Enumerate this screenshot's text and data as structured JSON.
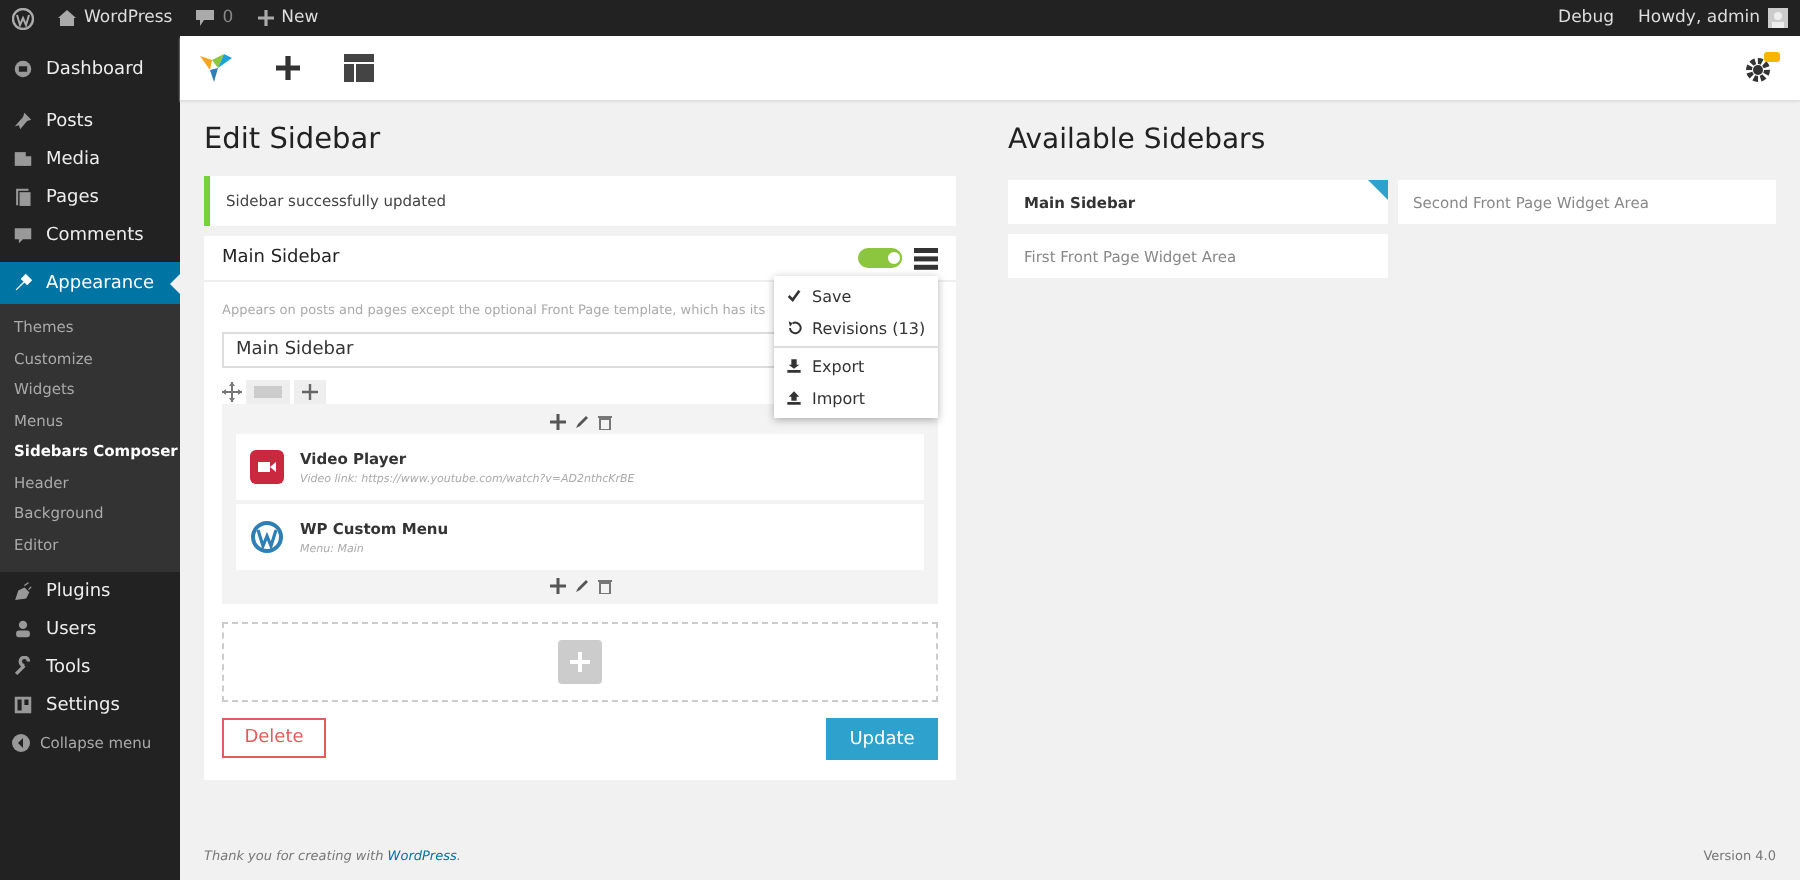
{
  "admin_bar": {
    "site": "WordPress",
    "comments": "0",
    "new": "New",
    "debug": "Debug",
    "greeting": "Howdy, admin"
  },
  "sidebar": {
    "items": [
      {
        "label": "Dashboard",
        "selected": false
      },
      {
        "label": "Posts",
        "selected": false
      },
      {
        "label": "Media",
        "selected": false
      },
      {
        "label": "Pages",
        "selected": false
      },
      {
        "label": "Comments",
        "selected": false
      },
      {
        "label": "Appearance",
        "selected": true,
        "children": [
          {
            "label": "Themes",
            "selected": false
          },
          {
            "label": "Customize",
            "selected": false
          },
          {
            "label": "Widgets",
            "selected": false
          },
          {
            "label": "Menus",
            "selected": false
          },
          {
            "label": "Sidebars Composer",
            "selected": true
          },
          {
            "label": "Header",
            "selected": false
          },
          {
            "label": "Background",
            "selected": false
          },
          {
            "label": "Editor",
            "selected": false
          }
        ]
      },
      {
        "label": "Plugins",
        "selected": false
      },
      {
        "label": "Users",
        "selected": false
      },
      {
        "label": "Tools",
        "selected": false
      },
      {
        "label": "Settings",
        "selected": false
      }
    ],
    "collapse": "Collapse menu"
  },
  "edit": {
    "title": "Edit Sidebar",
    "notice": "Sidebar successfully updated",
    "card": {
      "title": "Main Sidebar",
      "enabled": true,
      "description": "Appears on posts and pages except the optional Front Page template, which has its",
      "name_value": "Main Sidebar",
      "menu": [
        {
          "label": "Save",
          "divider_before": false
        },
        {
          "label": "Revisions (13)",
          "divider_before": false
        },
        {
          "label": "Export",
          "divider_before": true
        },
        {
          "label": "Import",
          "divider_before": false
        }
      ],
      "widgets": [
        {
          "title": "Video Player",
          "subtitle": "Video link: https://www.youtube.com/watch?v=AD2nthcKrBE",
          "kind": "video"
        },
        {
          "title": "WP Custom Menu",
          "subtitle": "Menu: Main",
          "kind": "wordpress"
        }
      ],
      "delete": "Delete",
      "update": "Update"
    }
  },
  "available": {
    "title": "Available Sidebars",
    "items": [
      {
        "label": "Main Sidebar",
        "selected": true
      },
      {
        "label": "Second Front Page Widget Area",
        "selected": false
      },
      {
        "label": "First Front Page Widget Area",
        "selected": false
      }
    ]
  },
  "footer": {
    "text": "Thank you for creating with ",
    "link": "WordPress",
    "after": ".",
    "version": "Version 4.0"
  }
}
